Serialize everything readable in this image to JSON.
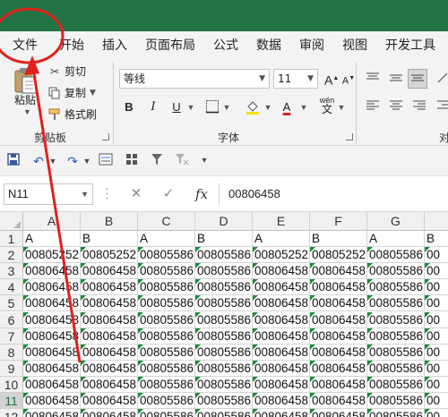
{
  "menubar": {
    "tabs": [
      "文件",
      "开始",
      "插入",
      "页面布局",
      "公式",
      "数据",
      "审阅",
      "视图",
      "开发工具"
    ]
  },
  "ribbon": {
    "clipboard": {
      "paste": "粘贴",
      "cut": "剪切",
      "copy": "复制",
      "format_painter": "格式刷",
      "group_label": "剪贴板"
    },
    "font": {
      "font_name": "等线",
      "font_size": "11",
      "bold": "B",
      "italic": "I",
      "underline": "U",
      "grow": "A",
      "shrink": "A",
      "font_color_glyph": "A",
      "phonetic": "wén",
      "group_label": "字体"
    },
    "align_group_partial": "对"
  },
  "formula_bar": {
    "name_box": "N11",
    "cancel": "✕",
    "enter": "✓",
    "fx": "fx",
    "value": "00806458"
  },
  "sheet": {
    "columns": [
      "A",
      "B",
      "C",
      "D",
      "E",
      "F",
      "G"
    ],
    "row_numbers": [
      "1",
      "2",
      "3",
      "4",
      "5",
      "6",
      "7",
      "8",
      "9",
      "10",
      "11",
      "12"
    ],
    "selected_row": "11",
    "rows": [
      [
        "A",
        "B",
        "A",
        "B",
        "A",
        "B",
        "A",
        "B"
      ],
      [
        "00805252",
        "00805252",
        "00805586",
        "00805586",
        "00805252",
        "00805252",
        "00805586",
        "00"
      ],
      [
        "00806458",
        "00806458",
        "00805586",
        "00805586",
        "00806458",
        "00806458",
        "00805586",
        "00"
      ],
      [
        "00806458",
        "00806458",
        "00805586",
        "00805586",
        "00806458",
        "00806458",
        "00805586",
        "00"
      ],
      [
        "00806458",
        "00806458",
        "00805586",
        "00805586",
        "00806458",
        "00806458",
        "00805586",
        "00"
      ],
      [
        "00806458",
        "00806458",
        "00805586",
        "00805586",
        "00806458",
        "00806458",
        "00805586",
        "00"
      ],
      [
        "00806458",
        "00806458",
        "00805586",
        "00805586",
        "00806458",
        "00806458",
        "00805586",
        "00"
      ],
      [
        "00806458",
        "00806458",
        "00805586",
        "00805586",
        "00806458",
        "00806458",
        "00805586",
        "00"
      ],
      [
        "00806458",
        "00806458",
        "00805586",
        "00805586",
        "00806458",
        "00806458",
        "00805586",
        "00"
      ],
      [
        "00806458",
        "00806458",
        "00805586",
        "00805586",
        "00806458",
        "00806458",
        "00805586",
        "00"
      ],
      [
        "00806458",
        "00806458",
        "00805586",
        "00805586",
        "00806458",
        "00806458",
        "00805586",
        "00"
      ],
      [
        "00806458",
        "00806458",
        "00805586",
        "00805586",
        "00806458",
        "00806458",
        "00805586",
        "00"
      ]
    ]
  },
  "colors": {
    "titlebar": "#217346",
    "annotation": "#e0211d",
    "error_indicator": "#1e8a3c"
  }
}
